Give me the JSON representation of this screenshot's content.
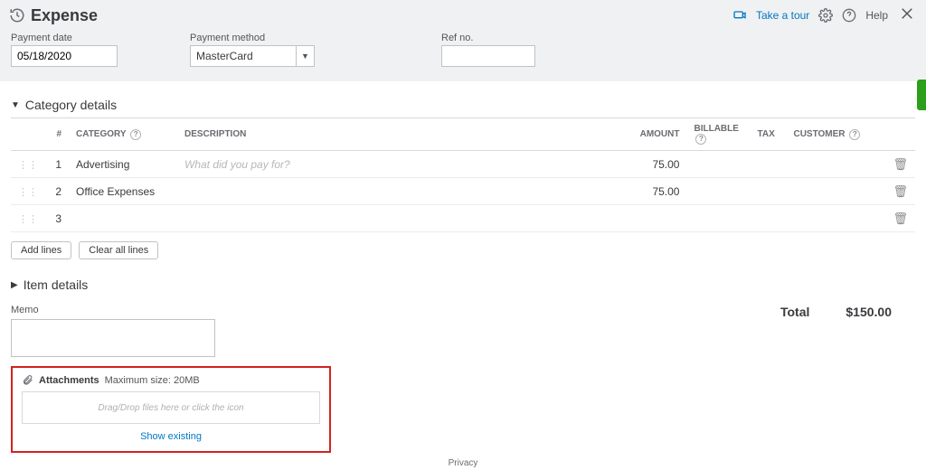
{
  "header": {
    "title": "Expense",
    "take_tour": "Take a tour",
    "help": "Help"
  },
  "fields": {
    "payment_date_label": "Payment date",
    "payment_date_value": "05/18/2020",
    "payment_method_label": "Payment method",
    "payment_method_value": "MasterCard",
    "ref_no_label": "Ref no.",
    "ref_no_value": ""
  },
  "category": {
    "section_title": "Category details",
    "cols": {
      "num": "#",
      "category": "CATEGORY",
      "description": "DESCRIPTION",
      "amount": "AMOUNT",
      "billable": "BILLABLE",
      "tax": "TAX",
      "customer": "CUSTOMER"
    },
    "rows": [
      {
        "num": "1",
        "category": "Advertising",
        "description": "",
        "description_placeholder": "What did you pay for?",
        "amount": "75.00"
      },
      {
        "num": "2",
        "category": "Office Expenses",
        "description": "",
        "description_placeholder": "",
        "amount": "75.00"
      },
      {
        "num": "3",
        "category": "",
        "description": "",
        "description_placeholder": "",
        "amount": ""
      }
    ],
    "add_lines": "Add lines",
    "clear_all": "Clear all lines"
  },
  "item_details": {
    "section_title": "Item details"
  },
  "memo": {
    "label": "Memo",
    "value": ""
  },
  "total": {
    "label": "Total",
    "value": "$150.00"
  },
  "attachments": {
    "label": "Attachments",
    "max": "Maximum size: 20MB",
    "drop_hint": "Drag/Drop files here or click the icon",
    "show_existing": "Show existing"
  },
  "footer": {
    "privacy": "Privacy"
  }
}
